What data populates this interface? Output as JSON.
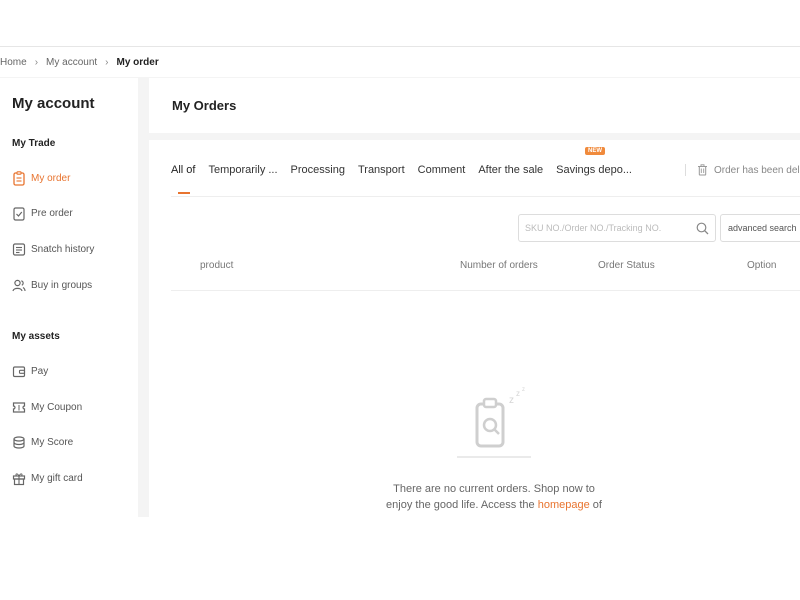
{
  "breadcrumb": {
    "home": "Home",
    "account": "My account",
    "current": "My order",
    "separator": "›"
  },
  "sidebar": {
    "title": "My account",
    "trade_heading": "My Trade",
    "trade_items": [
      {
        "label": "My order",
        "icon": "order-icon",
        "active": true
      },
      {
        "label": "Pre order",
        "icon": "checklist-icon",
        "active": false
      },
      {
        "label": "Snatch history",
        "icon": "history-icon",
        "active": false
      },
      {
        "label": "Buy in groups",
        "icon": "group-icon",
        "active": false
      }
    ],
    "assets_heading": "My assets",
    "asset_items": [
      {
        "label": "Pay",
        "icon": "wallet-icon"
      },
      {
        "label": "My Coupon",
        "icon": "coupon-icon"
      },
      {
        "label": "My Score",
        "icon": "coins-icon"
      },
      {
        "label": "My gift card",
        "icon": "gift-icon"
      }
    ]
  },
  "main": {
    "title": "My Orders",
    "tabs": [
      {
        "label": "All of",
        "active": true
      },
      {
        "label": "Temporarily ..."
      },
      {
        "label": "Processing"
      },
      {
        "label": "Transport"
      },
      {
        "label": "Comment"
      },
      {
        "label": "After the sale"
      },
      {
        "label": "Savings depo..."
      }
    ],
    "new_badge": "NEW",
    "deleted_link": "Order has been dele",
    "search_placeholder": "SKU NO./Order NO./Tracking NO.",
    "advanced_search": "advanced search",
    "columns": {
      "product": "product",
      "number_of_orders": "Number of orders",
      "order_status": "Order Status",
      "option": "Option"
    },
    "empty": {
      "line1": "There are no current orders. Shop now to",
      "line2_prefix": "enjoy the good life. Access the ",
      "link": "homepage",
      "line2_suffix": " of"
    }
  },
  "colors": {
    "accent": "#e8742f",
    "background": "#f4f4f4"
  }
}
